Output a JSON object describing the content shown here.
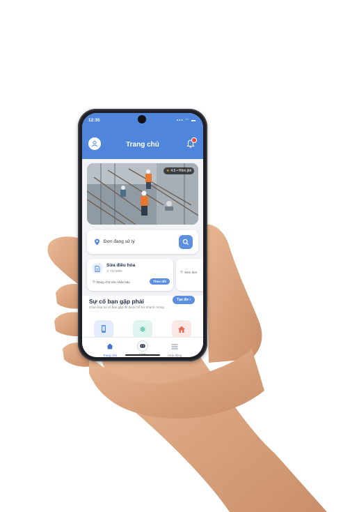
{
  "status_bar": {
    "time": "12:35",
    "indicators": "▪▪▪ ◠ ▬"
  },
  "header": {
    "title": "Trang chủ"
  },
  "banner": {
    "badge_text": "4.5 • Hôm jibl"
  },
  "search": {
    "text": "Đơn đang sử lý"
  },
  "request_card": {
    "title": "Sửa điều hòa",
    "subtitle": "Trọ Minh",
    "status": "Dang chở xác nhận báo",
    "button_label": "Theo dõi"
  },
  "request_card2": {
    "status": "Xem đơn"
  },
  "issues": {
    "title": "Sự cố bạn gặp phải",
    "description": "Chọn loại sự cố bạn gặp để được hỗ trợ nhanh chóng",
    "button_label": "Tạo đơ"
  },
  "categories": [
    {
      "icon": "phone-repair-icon"
    },
    {
      "icon": "snowflake-icon"
    },
    {
      "icon": "house-icon"
    }
  ],
  "tabbar": {
    "home_label": "Trang chủ",
    "mid_label": "Chat",
    "orders_label": "Hoạt động"
  },
  "colors": {
    "primary": "#4f86dc",
    "button": "#5c8fe0",
    "notification": "#e94b3c"
  }
}
